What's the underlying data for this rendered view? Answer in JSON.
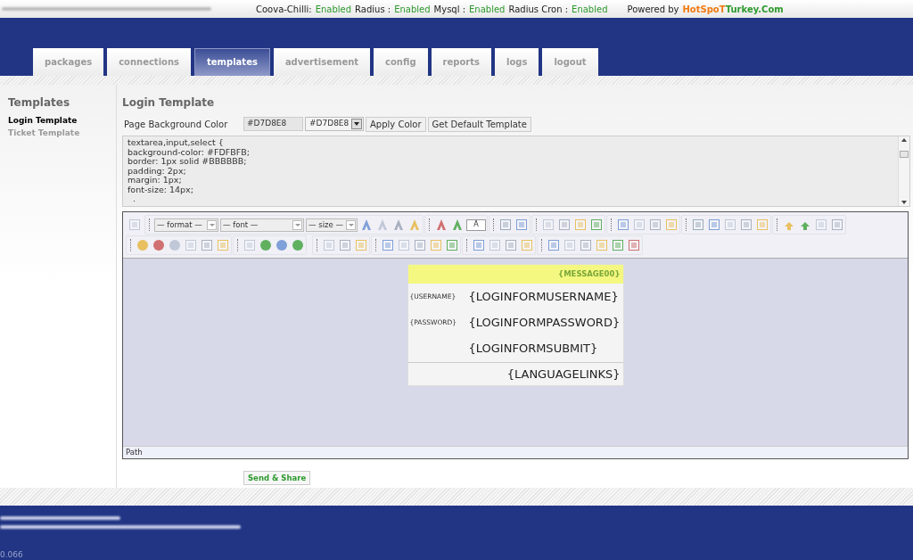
{
  "status_bar": {
    "items": [
      {
        "label": "Coova-Chilli:",
        "state": "Enabled"
      },
      {
        "label": "Radius :",
        "state": "Enabled"
      },
      {
        "label": "Mysql :",
        "state": "Enabled"
      },
      {
        "label": "Radius Cron :",
        "state": "Enabled"
      }
    ],
    "powered_by": "Powered by",
    "brand_first": "HotSpoT",
    "brand_second": "Turkey.Com"
  },
  "tabs": [
    {
      "label": "packages",
      "selected": false
    },
    {
      "label": "connections",
      "selected": false
    },
    {
      "label": "templates",
      "selected": true
    },
    {
      "label": "advertisement",
      "selected": false
    },
    {
      "label": "config",
      "selected": false
    },
    {
      "label": "reports",
      "selected": false
    },
    {
      "label": "logs",
      "selected": false
    },
    {
      "label": "logout",
      "selected": false
    }
  ],
  "sidebar": {
    "title": "Templates",
    "items": [
      {
        "label": "Login Template",
        "selected": true
      },
      {
        "label": "Ticket Template",
        "selected": false
      }
    ]
  },
  "main": {
    "title": "Login Template",
    "color_label": "Page Background Color",
    "color_input": "#D7D8E8",
    "color_select": "#D7D8E8",
    "buttons": [
      "Apply Color",
      "Get Default Template"
    ],
    "css_code": [
      "textarea,input,select {",
      "background-color: #FDFBFB;",
      "border: 1px solid #BBBBBB;",
      "padding: 2px;",
      "margin: 1px;",
      "font-size: 14px;",
      "  ."
    ],
    "editor": {
      "selects": [
        "— format —",
        "— font —",
        "— size —"
      ],
      "highlight_key": "A",
      "template": {
        "message": "{MESSAGE00}",
        "rows": [
          {
            "label": "{USERNAME}",
            "field": "{LOGINFORMUSERNAME}"
          },
          {
            "label": "{PASSWORD}",
            "field": "{LOGINFORMPASSWORD}"
          },
          {
            "field": "{LOGINFORMSUBMIT}"
          }
        ],
        "language_links": "{LANGUAGELINKS}"
      },
      "path_label": "Path"
    },
    "submit": "Send & Share"
  },
  "footer": {
    "timing": "0.066"
  }
}
